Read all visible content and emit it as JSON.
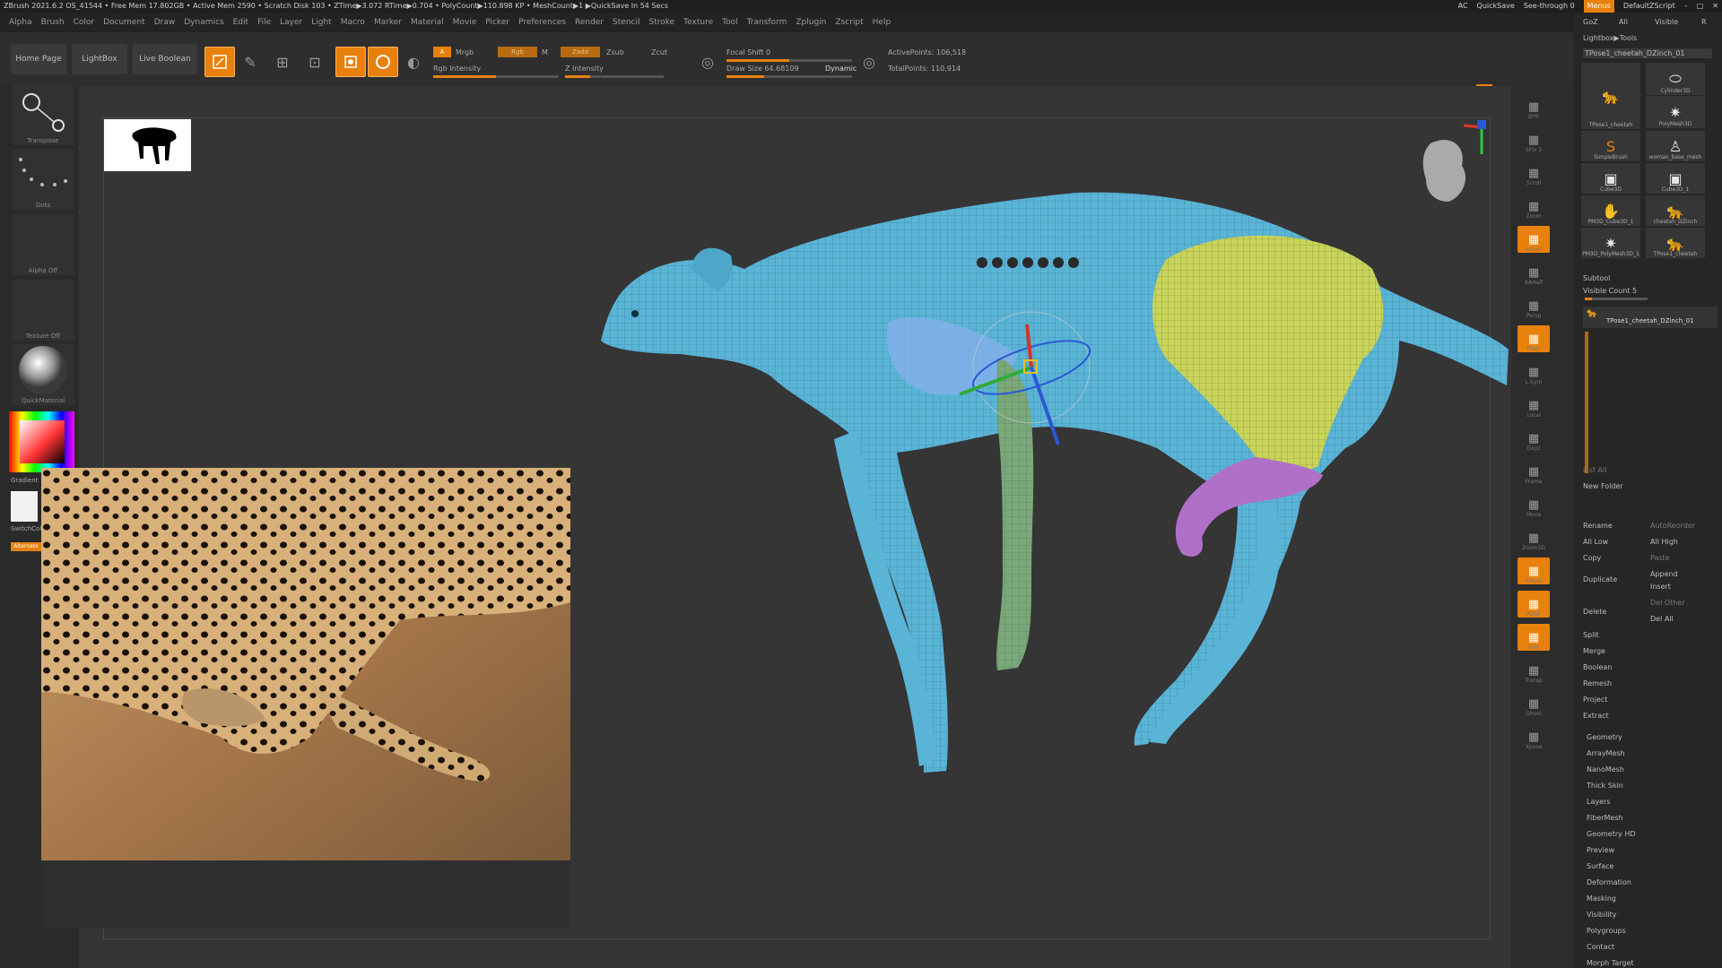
{
  "window": {
    "title": "ZBrush 2021.6.2   OS_41544   • Free Mem 17.802GB • Active Mem 2590 • Scratch Disk 103 • ZTime▶3.072 RTime▶0.704 • PolyCount▶110.898 KP • MeshCount▶1 ▶QuickSave In 54 Secs",
    "ac": "AC",
    "quicksave": "QuickSave",
    "see_through": "See-through 0",
    "menus_label": "Menus",
    "script_label": "DefaultZScript"
  },
  "menus": [
    "Alpha",
    "Brush",
    "Color",
    "Document",
    "Draw",
    "Dynamics",
    "Edit",
    "File",
    "Layer",
    "Light",
    "Macro",
    "Marker",
    "Material",
    "Movie",
    "Picker",
    "Preferences",
    "Render",
    "Stencil",
    "Stroke",
    "Texture",
    "Tool",
    "Transform",
    "Zplugin",
    "Zscript",
    "Help"
  ],
  "toolbar": {
    "home_page": "Home Page",
    "lightbox": "LightBox",
    "live_boolean": "Live Boolean",
    "edit": "Edit",
    "draw": "Draw",
    "move": "Move",
    "scale": "Scale",
    "rotate": "Rotate",
    "a_label": "A",
    "mrgb": "Mrgb",
    "rgb": "Rgb",
    "m": "M",
    "zadd": "Zadd",
    "zsub": "Zsub",
    "zcut": "Zcut",
    "rgb_intensity": "Rgb Intensity",
    "z_intensity": "Z Intensity",
    "focal_shift": "Focal Shift 0",
    "draw_size": "Draw Size 64.68109",
    "dynamic": "Dynamic",
    "active_points": "ActivePoints: 106,518",
    "total_points": "TotalPoints: 110,914"
  },
  "sliders": {
    "rgb_intensity": 0.5,
    "z_intensity": 0.25,
    "focal_shift": 0.5,
    "draw_size": 0.3
  },
  "leftbar": {
    "transpose": "Transpose",
    "dots": "Dots",
    "alpha_off": "Alpha Off",
    "texture_off": "Texture Off",
    "material": "QuickMaterial",
    "gradient": "Gradient",
    "switch_color": "SwitchColor",
    "alternate": "Alternate"
  },
  "rightshelf": [
    "BPR",
    "SPix 3",
    "Scroll",
    "Zoom",
    "Actual",
    "AAHalf",
    "Persp",
    "Floor",
    "L.Sym",
    "Local",
    "Gxyz",
    "Frame",
    "Move",
    "Zoom3D",
    "Rotate",
    "PolyF",
    "Solo",
    "Transp",
    "Ghost",
    "Xpose"
  ],
  "tray": {
    "goz": "GoZ",
    "all": "All",
    "visible": "Visible",
    "r": "R",
    "lightbox_tools": "Lightbox▶Tools",
    "current_tool": "TPose1_cheetah_DZinch_01",
    "tools": [
      {
        "label": "TPose1_cheetah",
        "icon": "cheetah-icon"
      },
      {
        "label": "Cylinder3D",
        "icon": "cylinder-icon"
      },
      {
        "label": "PolyMesh3D",
        "icon": "star-icon"
      },
      {
        "label": "SimpleBrush",
        "icon": "simple-brush-icon"
      },
      {
        "label": "woman_base_mesh",
        "icon": "figure-icon"
      },
      {
        "label": "Cube3D",
        "icon": "cube-icon"
      },
      {
        "label": "Cube3D_1",
        "icon": "cube-icon"
      },
      {
        "label": "PM3D_Cube3D_1",
        "icon": "hand-icon"
      },
      {
        "label": "cheetah_DZinch",
        "icon": "cheetah-icon"
      },
      {
        "label": "PM3D_PolyMesh3D_1",
        "icon": "star-icon"
      },
      {
        "label": "TPose1_cheetah",
        "icon": "cheetah-icon"
      }
    ],
    "subtool": "Subtool",
    "visible_count": "Visible Count 5",
    "subtool_item": "TPose1_cheetah_DZinch_01",
    "list_all": "List All",
    "new_folder": "New Folder",
    "actions_left": [
      "Rename",
      "All Low",
      "Copy",
      "Duplicate",
      "Delete"
    ],
    "actions_right": [
      "AutoReorder",
      "All High",
      "Paste",
      "Append",
      "Insert",
      "Del Other",
      "Del All"
    ],
    "sub_menu": [
      "Split",
      "Merge",
      "Boolean",
      "Remesh",
      "Project",
      "Extract"
    ],
    "tool_menu": [
      "Geometry",
      "ArrayMesh",
      "NanoMesh",
      "Thick Skin",
      "Layers",
      "FiberMesh",
      "Geometry HD",
      "Preview",
      "Surface",
      "Deformation",
      "Masking",
      "Visibility",
      "Polygroups",
      "Contact",
      "Morph Target"
    ]
  },
  "colors": {
    "accent": "#e8810c",
    "mesh_blue": "#5ab4d6",
    "group_yellow": "#c8d45a",
    "group_purple": "#b070c8",
    "group_green": "#7aa878",
    "group_lightblue": "#7eb0e8"
  }
}
